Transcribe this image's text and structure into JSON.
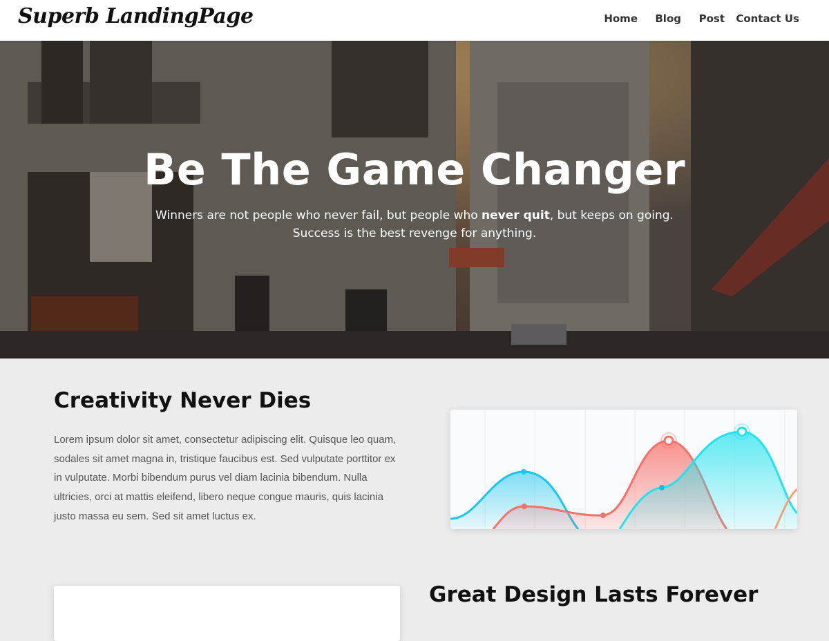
{
  "header": {
    "logo": "Superb LandingPage",
    "nav": [
      {
        "label": "Home"
      },
      {
        "label": "Blog"
      },
      {
        "label": "Post"
      },
      {
        "label": "Contact Us"
      }
    ]
  },
  "hero": {
    "title": "Be The Game Changer",
    "subtitle_before": "Winners are not people who never fail, but people who ",
    "subtitle_bold": "never quit",
    "subtitle_after": ", but keeps on going.",
    "subtitle_line2": "Success is the best revenge for anything."
  },
  "section1": {
    "title": "Creativity Never Dies",
    "body": "Lorem ipsum dolor sit amet, consectetur adipiscing elit. Quisque leo quam, sodales sit amet magna in, tristique faucibus est. Sed vulputate porttitor ex in vulputate. Morbi bibendum purus vel diam lacinia bibendum. Nulla ultricies, orci at mattis eleifend, libero neque congue mauris, quis lacinia justo massa eu sem. Sed sit amet luctus ex."
  },
  "section2": {
    "title": "Great Design Lasts Forever"
  },
  "colors": {
    "series_blue": "#19c6f0",
    "series_red": "#f7706a",
    "series_cyan": "#1fe3ef"
  }
}
